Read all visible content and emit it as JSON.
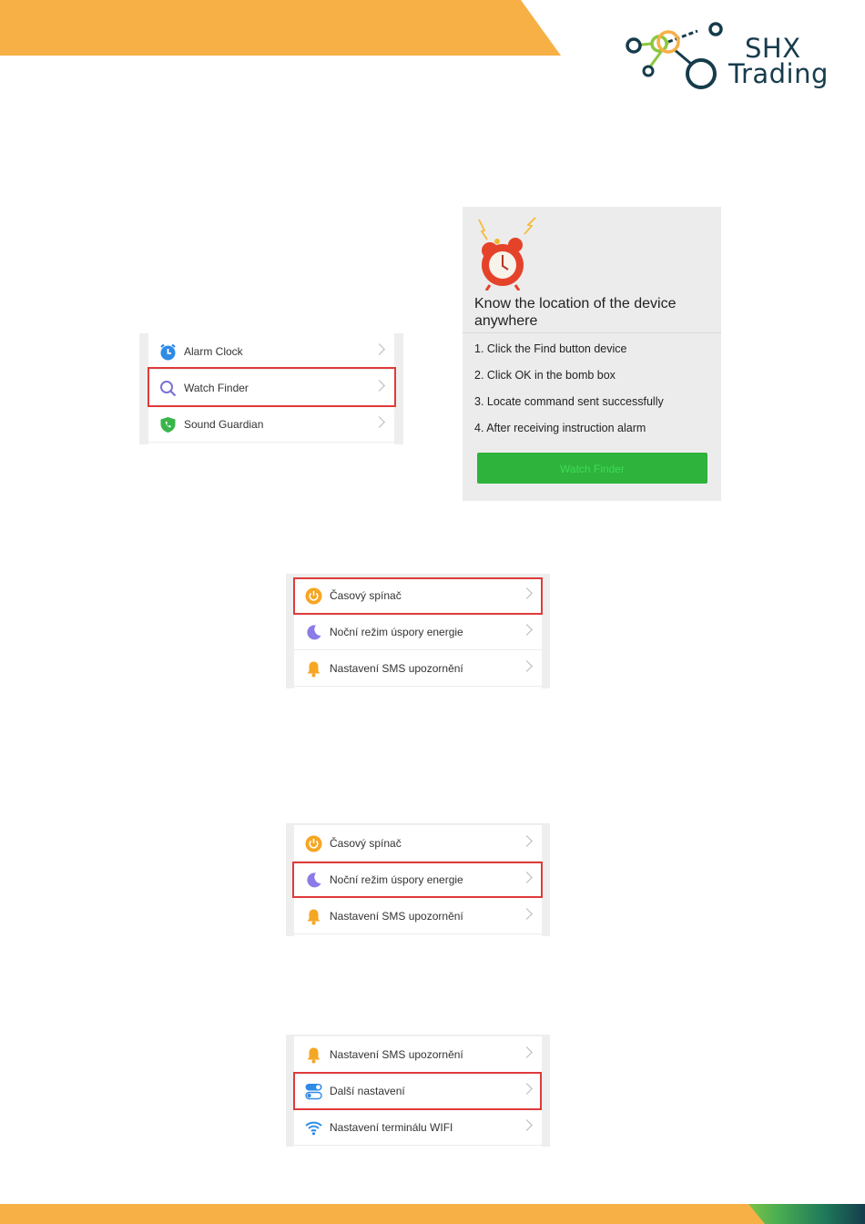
{
  "brand": {
    "line1": "SHX",
    "line2": "Trading",
    "colors": {
      "orange": "#f7b046",
      "dark": "#163c4c",
      "green": "#8cc63f"
    }
  },
  "menu1": {
    "items": [
      {
        "label": "Alarm Clock",
        "icon": "alarm-clock-icon"
      },
      {
        "label": "Watch Finder",
        "icon": "search-icon"
      },
      {
        "label": "Sound Guardian",
        "icon": "phone-shield-icon"
      }
    ]
  },
  "finder": {
    "title": "Know the location of the device anywhere",
    "steps": [
      "1. Click the Find button device",
      "2. Click OK in the bomb box",
      "3. Locate command sent successfully",
      "4. After receiving instruction alarm"
    ],
    "button_label": "Watch Finder",
    "button_color": "#2eb33c"
  },
  "menu2": {
    "items": [
      {
        "label": "Časový spínač",
        "icon": "timer-power-icon"
      },
      {
        "label": "Noční režim úspory energie",
        "icon": "moon-icon"
      },
      {
        "label": "Nastavení SMS upozornění",
        "icon": "bell-icon"
      }
    ]
  },
  "menu3": {
    "items": [
      {
        "label": "Časový spínač",
        "icon": "timer-power-icon"
      },
      {
        "label": "Noční režim úspory energie",
        "icon": "moon-icon"
      },
      {
        "label": "Nastavení SMS upozornění",
        "icon": "bell-icon"
      }
    ]
  },
  "menu4": {
    "items": [
      {
        "label": "Nastavení SMS upozornění",
        "icon": "bell-icon"
      },
      {
        "label": "Další nastavení",
        "icon": "toggle-icon"
      },
      {
        "label": "Nastavení terminálu WIFI",
        "icon": "wifi-icon"
      }
    ]
  },
  "highlight_color": "#e03a3a"
}
